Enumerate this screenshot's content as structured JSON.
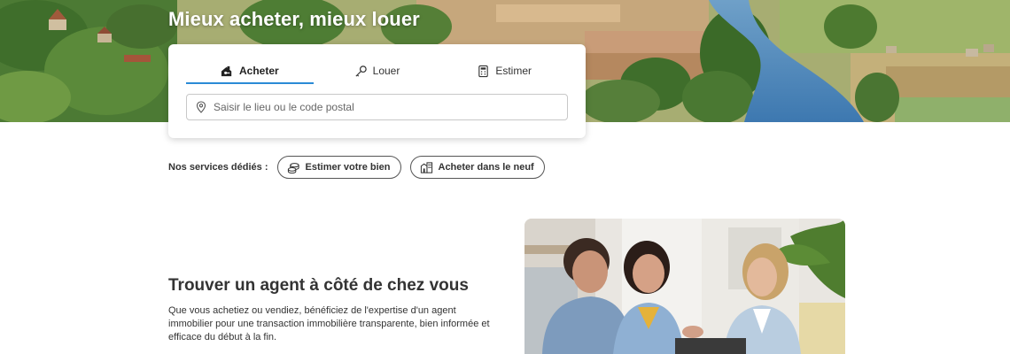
{
  "hero": {
    "title": "Mieux acheter, mieux louer"
  },
  "search": {
    "tabs": [
      {
        "label": "Acheter",
        "icon": "house-key-icon",
        "active": true
      },
      {
        "label": "Louer",
        "icon": "key-icon",
        "active": false
      },
      {
        "label": "Estimer",
        "icon": "calculator-icon",
        "active": false
      }
    ],
    "placeholder": "Saisir le lieu ou le code postal",
    "value": ""
  },
  "services": {
    "label": "Nos services dédiés :",
    "buttons": [
      {
        "label": "Estimer votre bien",
        "icon": "coins-icon"
      },
      {
        "label": "Acheter dans le neuf",
        "icon": "new-building-icon"
      }
    ]
  },
  "agent": {
    "title": "Trouver un agent à côté de chez vous",
    "text": "Que vous achetiez ou vendiez, bénéficiez de l'expertise d'un agent immobilier pour une transaction immobilière transparente, bien informée et efficace du début à la fin."
  },
  "colors": {
    "accent": "#2a8bd6",
    "text": "#333333",
    "border": "#c8c8c8"
  }
}
